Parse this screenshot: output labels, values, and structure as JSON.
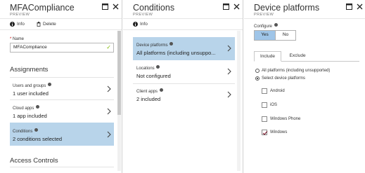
{
  "blade1": {
    "title": "MFACompliance",
    "subtitle": "PREVIEW",
    "toolbar": {
      "info_label": "Info",
      "delete_label": "Delete"
    },
    "name_field": {
      "label": "Name",
      "value": "MFACompliance"
    },
    "assignments_title": "Assignments",
    "cards": [
      {
        "key": "Users and groups",
        "value": "1 user included"
      },
      {
        "key": "Cloud apps",
        "value": "1 app included"
      },
      {
        "key": "Conditions",
        "value": "2 conditions selected"
      }
    ],
    "access_controls_title": "Access Controls"
  },
  "blade2": {
    "title": "Conditions",
    "subtitle": "PREVIEW",
    "toolbar": {
      "info_label": "Info"
    },
    "cards": [
      {
        "key": "Device platforms",
        "value": "All platforms (including unsuppo..."
      },
      {
        "key": "Locations",
        "value": "Not configured"
      },
      {
        "key": "Client apps",
        "value": "2 included"
      }
    ]
  },
  "blade3": {
    "title": "Device platforms",
    "subtitle": "PREVIEW",
    "configure_label": "Configure",
    "toggle": {
      "yes": "Yes",
      "no": "No",
      "selected": "Yes"
    },
    "tabs": {
      "include": "Include",
      "exclude": "Exclude"
    },
    "radios": [
      {
        "label": "All platforms (including unsupported)",
        "checked": false
      },
      {
        "label": "Select device platforms",
        "checked": true
      }
    ],
    "platforms": [
      {
        "label": "Android",
        "checked": false
      },
      {
        "label": "iOS",
        "checked": false
      },
      {
        "label": "Windows Phone",
        "checked": false
      },
      {
        "label": "Windows",
        "checked": true
      }
    ]
  },
  "colors": {
    "selected_bg": "#b8d4ea",
    "toggle_on": "#9fc5e8",
    "valid_check": "#7fba00"
  },
  "icons": [
    "info-icon",
    "delete-icon",
    "maximize-icon",
    "close-icon",
    "chevron-right-icon",
    "checkmark-icon"
  ]
}
